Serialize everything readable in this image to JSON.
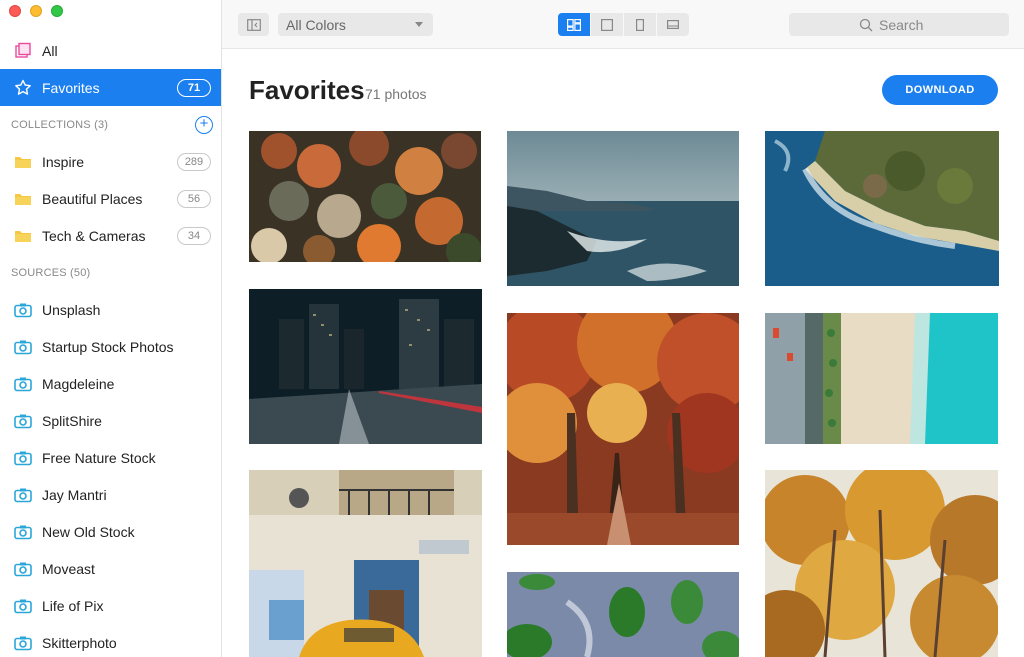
{
  "sidebar": {
    "all": {
      "label": "All",
      "icon": "all-photos-icon"
    },
    "favorites": {
      "label": "Favorites",
      "count": "71",
      "icon": "star-icon"
    },
    "collections_header": "COLLECTIONS (3)",
    "collections": [
      {
        "label": "Inspire",
        "count": "289"
      },
      {
        "label": "Beautiful Places",
        "count": "56"
      },
      {
        "label": "Tech & Cameras",
        "count": "34"
      }
    ],
    "sources_header": "SOURCES (50)",
    "sources": [
      {
        "label": "Unsplash"
      },
      {
        "label": "Startup Stock Photos"
      },
      {
        "label": "Magdeleine"
      },
      {
        "label": "SplitShire"
      },
      {
        "label": "Free Nature Stock"
      },
      {
        "label": "Jay Mantri"
      },
      {
        "label": "New Old Stock"
      },
      {
        "label": "Moveast"
      },
      {
        "label": "Life of Pix"
      },
      {
        "label": "Skitterphoto"
      }
    ]
  },
  "toolbar": {
    "color_filter": "All Colors",
    "search_placeholder": "Search"
  },
  "main": {
    "title": "Favorites",
    "subtitle": "71 photos",
    "download_label": "DOWNLOAD"
  },
  "colors": {
    "accent": "#1b7ff0",
    "folder": "#f5c742",
    "camera": "#2aa7d8"
  }
}
